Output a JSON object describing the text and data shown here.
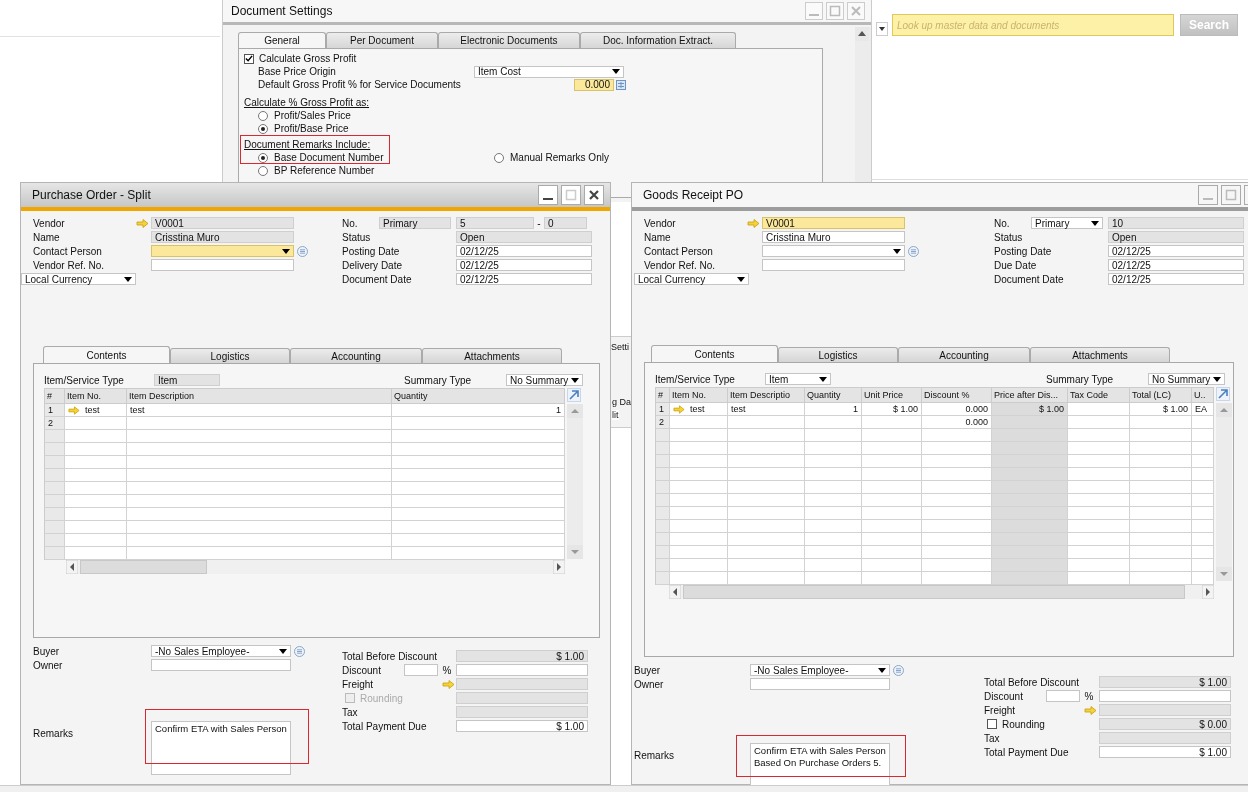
{
  "background_window": {
    "fragments": [
      "Setti",
      "g Da",
      "lit"
    ]
  },
  "document_settings": {
    "title": "Document Settings",
    "tabs": [
      {
        "label": "General",
        "selected": true
      },
      {
        "label": "Per Document",
        "selected": false
      },
      {
        "label": "Electronic Documents",
        "selected": false
      },
      {
        "label": "Doc. Information Extract.",
        "selected": false
      }
    ],
    "gross_profit": {
      "label": "Calculate Gross Profit",
      "checked": true
    },
    "base_price_origin": {
      "label": "Base Price Origin",
      "value": "Item Cost"
    },
    "default_gross_profit": {
      "label": "Default Gross Profit % for Service Documents",
      "value": "0.000"
    },
    "calc_heading": "Calculate % Gross Profit as:",
    "calc_options": [
      {
        "label": "Profit/Sales Price",
        "selected": false
      },
      {
        "label": "Profit/Base Price",
        "selected": true
      }
    ],
    "remarks_heading": "Document Remarks Include:",
    "remarks_highlighted": true,
    "remarks_options": [
      {
        "label": "Base Document Number",
        "selected": true
      },
      {
        "label": "Manual Remarks Only",
        "selected": false
      },
      {
        "label": "BP Reference Number",
        "selected": false
      }
    ]
  },
  "search": {
    "placeholder": "Look up master data and documents",
    "button": "Search"
  },
  "windows": [
    {
      "title": "Purchase Order - Split",
      "active": true,
      "header_left": [
        {
          "label": "Vendor",
          "value": "V0001",
          "kind": "readonly",
          "link_arrow": true,
          "dropdown": false,
          "picker": false
        },
        {
          "label": "Name",
          "value": "Crisstina Muro",
          "kind": "readonly",
          "link_arrow": false,
          "dropdown": false,
          "picker": false
        },
        {
          "label": "Contact Person",
          "kind": "highlight",
          "link_arrow": false,
          "dropdown": true,
          "picker": true
        },
        {
          "label": "Vendor Ref. No.",
          "kind": "text",
          "link_arrow": false,
          "dropdown": false,
          "picker": false
        }
      ],
      "currency": {
        "value": "Local Currency"
      },
      "number": {
        "label": "No.",
        "series": "Primary",
        "series_dropdown": false,
        "value": "5",
        "separator": "-",
        "extension": "0"
      },
      "header_right": [
        {
          "label": "Status",
          "value": "Open",
          "kind": "readonly"
        },
        {
          "label": "Posting Date",
          "value": "02/12/25",
          "kind": "text"
        },
        {
          "label": "Delivery Date",
          "value": "02/12/25",
          "kind": "text"
        },
        {
          "label": "Document Date",
          "value": "02/12/25",
          "kind": "text"
        }
      ],
      "tabs": [
        {
          "label": "Contents",
          "selected": true
        },
        {
          "label": "Logistics",
          "selected": false
        },
        {
          "label": "Accounting",
          "selected": false
        },
        {
          "label": "Attachments",
          "selected": false
        }
      ],
      "item_type": {
        "label": "Item/Service Type",
        "value": "Item",
        "dropdown": false
      },
      "summary": {
        "label": "Summary Type",
        "value": "No Summary"
      },
      "columns": [
        {
          "label": "#",
          "numeric": false,
          "readonly": false
        },
        {
          "label": "Item No.",
          "numeric": false,
          "readonly": false
        },
        {
          "label": "Item Description",
          "numeric": false,
          "readonly": false
        },
        {
          "label": "Quantity",
          "numeric": true,
          "readonly": false
        }
      ],
      "rows": [
        {
          "cells": [
            "1",
            "test",
            "test",
            "1"
          ],
          "link": true
        },
        {
          "cells": [
            "2",
            null,
            null,
            null
          ],
          "link": false
        }
      ],
      "buyer": {
        "label": "Buyer",
        "value": "-No Sales Employee-"
      },
      "owner": {
        "label": "Owner"
      },
      "totals": [
        {
          "kind": "amount",
          "label": "Total Before Discount",
          "value": "$ 1.00",
          "editable": false
        },
        {
          "kind": "discount",
          "label": "Discount",
          "symbol": "%"
        },
        {
          "kind": "freight",
          "label": "Freight"
        },
        {
          "kind": "rounding",
          "label": "Rounding",
          "checked": false,
          "disabled": true
        },
        {
          "kind": "tax",
          "label": "Tax"
        },
        {
          "kind": "amount",
          "label": "Total Payment Due",
          "value": "$ 1.00",
          "editable": true
        }
      ],
      "remarks": {
        "label": "Remarks",
        "value": "Confirm ETA with Sales Person",
        "highlighted": true
      }
    },
    {
      "title": "Goods Receipt PO",
      "active": false,
      "header_left": [
        {
          "label": "Vendor",
          "value": "V0001",
          "kind": "highlight",
          "link_arrow": true,
          "dropdown": false,
          "picker": false
        },
        {
          "label": "Name",
          "value": "Crisstina Muro",
          "kind": "text",
          "link_arrow": false,
          "dropdown": false,
          "picker": false
        },
        {
          "label": "Contact Person",
          "kind": "text",
          "link_arrow": false,
          "dropdown": true,
          "picker": true
        },
        {
          "label": "Vendor Ref. No.",
          "kind": "text",
          "link_arrow": false,
          "dropdown": false,
          "picker": false
        }
      ],
      "currency": {
        "value": "Local Currency"
      },
      "number": {
        "label": "No.",
        "series": "Primary",
        "series_dropdown": true,
        "value": "10"
      },
      "header_right": [
        {
          "label": "Status",
          "value": "Open",
          "kind": "readonly"
        },
        {
          "label": "Posting Date",
          "value": "02/12/25",
          "kind": "text"
        },
        {
          "label": "Due Date",
          "value": "02/12/25",
          "kind": "text"
        },
        {
          "label": "Document Date",
          "value": "02/12/25",
          "kind": "text"
        }
      ],
      "tabs": [
        {
          "label": "Contents",
          "selected": true
        },
        {
          "label": "Logistics",
          "selected": false
        },
        {
          "label": "Accounting",
          "selected": false
        },
        {
          "label": "Attachments",
          "selected": false
        }
      ],
      "item_type": {
        "label": "Item/Service Type",
        "value": "Item",
        "dropdown": true
      },
      "summary": {
        "label": "Summary Type",
        "value": "No Summary"
      },
      "columns": [
        {
          "label": "#",
          "numeric": false,
          "readonly": false
        },
        {
          "label": "Item No.",
          "numeric": false,
          "readonly": false
        },
        {
          "label": "Item Descriptio",
          "numeric": false,
          "readonly": false
        },
        {
          "label": "Quantity",
          "numeric": true,
          "readonly": false
        },
        {
          "label": "Unit Price",
          "numeric": true,
          "readonly": false
        },
        {
          "label": "Discount %",
          "numeric": true,
          "readonly": false
        },
        {
          "label": "Price after Dis...",
          "numeric": true,
          "readonly": true
        },
        {
          "label": "Tax Code",
          "readonly": false
        },
        {
          "label": "Total (LC)",
          "numeric": true,
          "readonly": false
        },
        {
          "label": "U..",
          "numeric": false,
          "readonly": false
        }
      ],
      "rows": [
        {
          "cells": [
            "1",
            "test",
            "test",
            "1",
            "$ 1.00",
            "0.000",
            "$ 1.00",
            null,
            "$ 1.00",
            "EA"
          ],
          "link": true
        },
        {
          "cells": [
            "2",
            null,
            null,
            null,
            null,
            "0.000",
            null,
            null,
            null,
            null
          ],
          "link": false
        }
      ],
      "buyer": {
        "label": "Buyer",
        "value": "-No Sales Employee-"
      },
      "owner": {
        "label": "Owner"
      },
      "totals": [
        {
          "kind": "amount",
          "label": "Total Before Discount",
          "value": "$ 1.00",
          "editable": false
        },
        {
          "kind": "discount",
          "label": "Discount",
          "symbol": "%"
        },
        {
          "kind": "freight",
          "label": "Freight"
        },
        {
          "kind": "rounding",
          "label": "Rounding",
          "checked": false,
          "disabled": false,
          "value": "$ 0.00"
        },
        {
          "kind": "tax",
          "label": "Tax"
        },
        {
          "kind": "amount",
          "label": "Total Payment Due",
          "value": "$ 1.00",
          "editable": true
        }
      ],
      "remarks": {
        "label": "Remarks",
        "value": "Confirm ETA with Sales Person\nBased On Purchase Orders 5.",
        "highlighted": true
      }
    }
  ]
}
